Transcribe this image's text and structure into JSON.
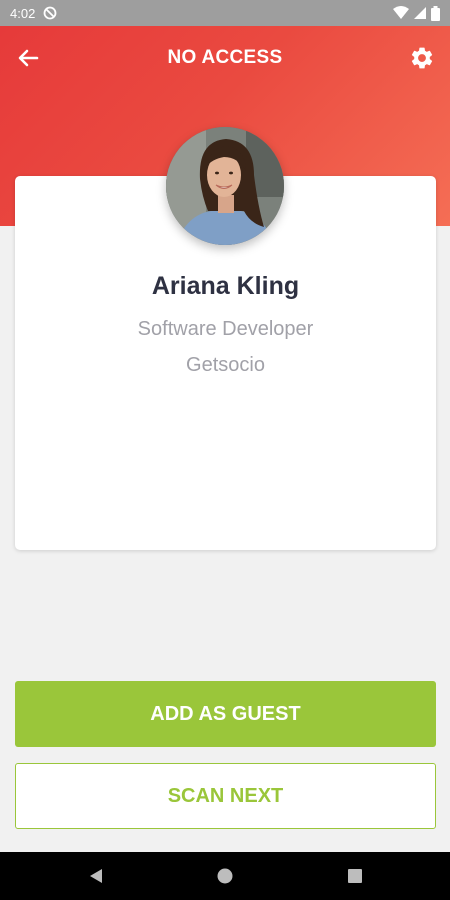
{
  "status_bar": {
    "time": "4:02",
    "icons": [
      "do-not-disturb-icon",
      "wifi-icon",
      "signal-icon",
      "battery-icon"
    ]
  },
  "header": {
    "title": "NO ACCESS",
    "back_icon": "arrow-left-icon",
    "settings_icon": "gear-icon"
  },
  "profile": {
    "name": "Ariana Kling",
    "role": "Software Developer",
    "company": "Getsocio"
  },
  "actions": {
    "add_guest_label": "ADD AS GUEST",
    "scan_next_label": "SCAN NEXT"
  },
  "navigation": {
    "icons": [
      "back-triangle-icon",
      "home-circle-icon",
      "recents-square-icon"
    ]
  },
  "colors": {
    "header_gradient_start": "#e63a3a",
    "header_gradient_end": "#f56e55",
    "accent_green": "#9ac63a",
    "name_text": "#2e3142",
    "secondary_text": "#a1a1a8",
    "background": "#f1f1f1"
  }
}
